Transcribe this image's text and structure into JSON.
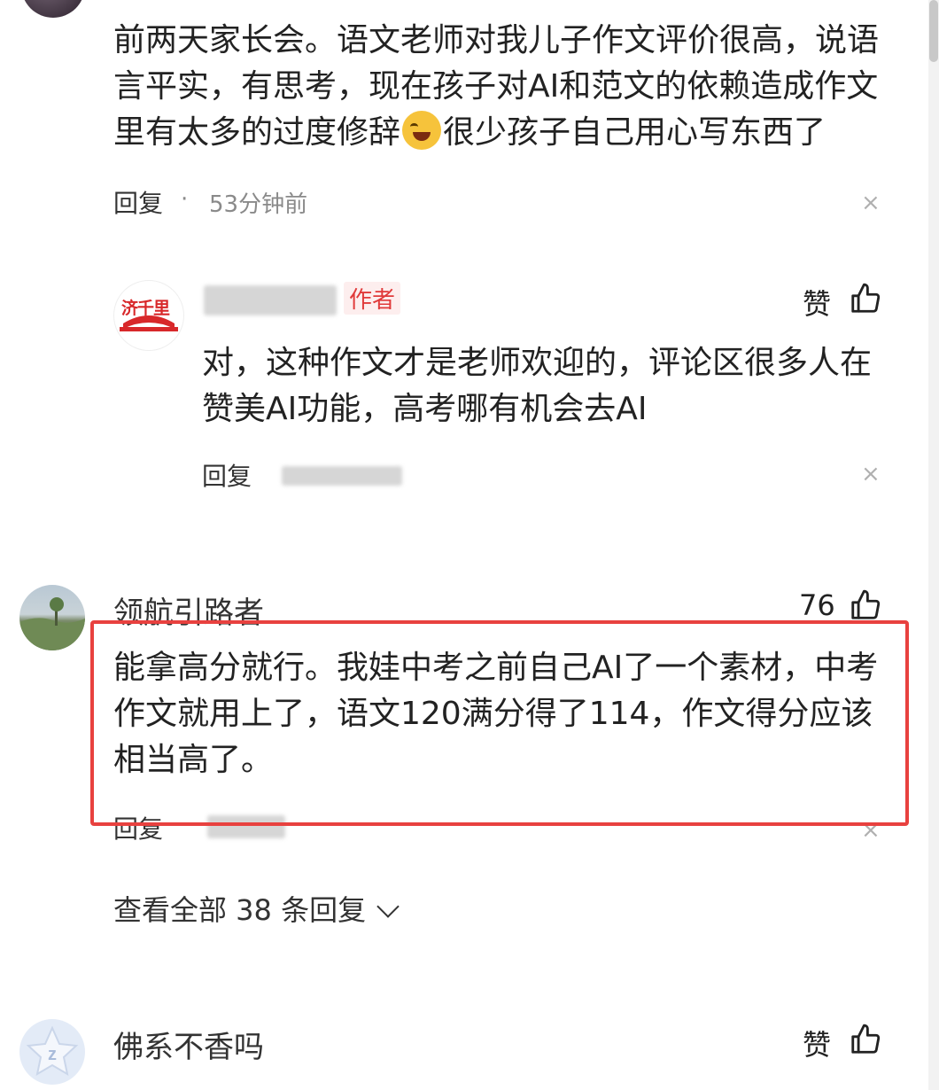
{
  "comment1": {
    "text": "前两天家长会。语文老师对我儿子作文评价很高，说语言平实，有思考，现在孩子对AI和范文的依赖造成作文里有太多的过度修辞",
    "text_after_emoji": "很少孩子自己用心写东西了",
    "reply_label": "回复",
    "separator": "·",
    "timestamp": "53分钟前",
    "close_symbol": "×"
  },
  "reply1": {
    "avatar_logo_text": "济千里",
    "author_tag": "作者",
    "like_label": "赞",
    "text": "对，这种作文才是老师欢迎的，评论区很多人在赞美AI功能，高考哪有机会去AI",
    "reply_label": "回复",
    "close_symbol": "×"
  },
  "comment2": {
    "username": "领航引路者",
    "like_count": "76",
    "text": "能拿高分就行。我娃中考之前自己AI了一个素材，中考作文就用上了，语文120满分得了114，作文得分应该相当高了。",
    "reply_label": "回复",
    "close_symbol": "×",
    "view_all_replies": "查看全部 38 条回复",
    "chevron": "⌄"
  },
  "comment3": {
    "username": "佛系不香吗",
    "like_label": "赞"
  },
  "colors": {
    "highlight": "#e8413f",
    "author_tag": "#e03a3a",
    "gray_text": "#8a8a8a"
  },
  "icons": [
    "thumbs-up-icon",
    "close-icon",
    "chevron-down-icon",
    "laughing-crying-emoji-icon"
  ]
}
